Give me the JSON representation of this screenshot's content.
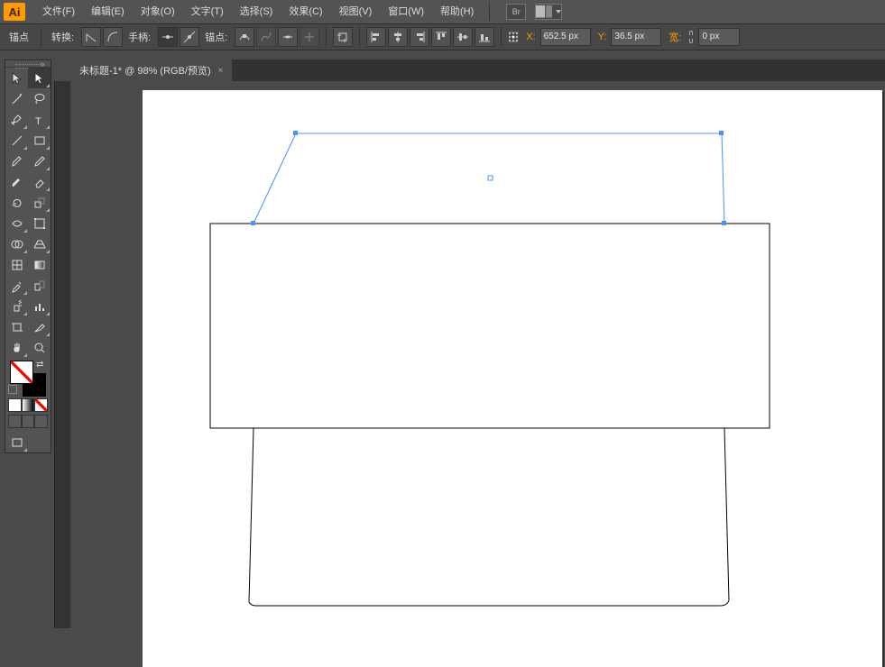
{
  "menu": {
    "items": [
      "文件(F)",
      "编辑(E)",
      "对象(O)",
      "文字(T)",
      "选择(S)",
      "效果(C)",
      "视图(V)",
      "窗口(W)",
      "帮助(H)"
    ],
    "bridge_label": "Br"
  },
  "optbar": {
    "anchor_label": "锚点",
    "convert_label": "转换:",
    "handle_label": "手柄:",
    "anchors_label": "锚点:",
    "x_label": "X:",
    "y_label": "Y:",
    "w_label": "宽:",
    "x_value": "652.5 px",
    "y_value": "36.5 px",
    "w_value": "0 px"
  },
  "tab": {
    "title": "未标题-1* @ 98% (RGB/预览)",
    "close": "×"
  },
  "tools": {
    "selection": "selection",
    "direct": "direct-selection",
    "wand": "magic-wand",
    "lasso": "lasso",
    "pen": "pen",
    "type": "type",
    "line": "line",
    "rect": "rectangle",
    "brush": "paintbrush",
    "pencil": "pencil",
    "blob": "blob-brush",
    "eraser": "eraser",
    "rotate": "rotate",
    "scale": "scale",
    "width": "width",
    "free": "free-transform",
    "shapebuilder": "shape-builder",
    "persp": "perspective-grid",
    "mesh": "mesh",
    "gradient": "gradient",
    "eyedrop": "eyedropper",
    "blend": "blend",
    "spray": "symbol-sprayer",
    "graph": "column-graph",
    "artboard": "artboard",
    "slice": "slice",
    "hand": "hand",
    "zoom": "zoom"
  },
  "opt_icons": {
    "corner": "corner-anchor",
    "smooth": "smooth-anchor",
    "show": "show-handles",
    "hide": "hide-handles",
    "remove": "remove-anchor",
    "cut": "cut-path",
    "connect": "connect-anchors",
    "align": "align-to-pixel",
    "crop": "crop",
    "al": "align-left",
    "ahc": "align-hcenter",
    "ar": "align-right",
    "at": "align-top",
    "avc": "align-vcenter",
    "ab": "align-bottom",
    "link": "link-wh"
  }
}
